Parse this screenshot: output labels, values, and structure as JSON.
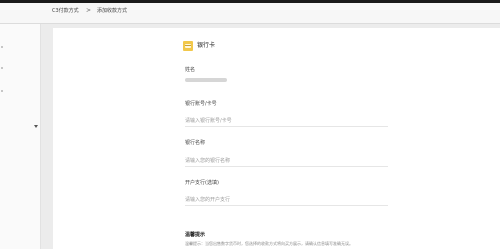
{
  "breadcrumb": {
    "parent": "C3付款方式",
    "separator": ">",
    "current": "添加收款方式"
  },
  "card": {
    "icon": "bank-card-icon",
    "title": "银行卡"
  },
  "form": {
    "name_label": "姓名",
    "account_label": "银行账号/卡号",
    "account_placeholder": "请输入银行账号/卡号",
    "bank_label": "银行名称",
    "bank_placeholder": "请输入您的银行名称",
    "branch_label": "开户支行(选填)",
    "branch_placeholder": "请输入您的开户支行"
  },
  "tips": {
    "title": "温馨提示",
    "text": "温馨提示：当您出售数字货币时，您选择的收款方式将向买方展示，请确认信息填写准确无误。"
  },
  "colors": {
    "icon_yellow": "#f2c84b"
  }
}
